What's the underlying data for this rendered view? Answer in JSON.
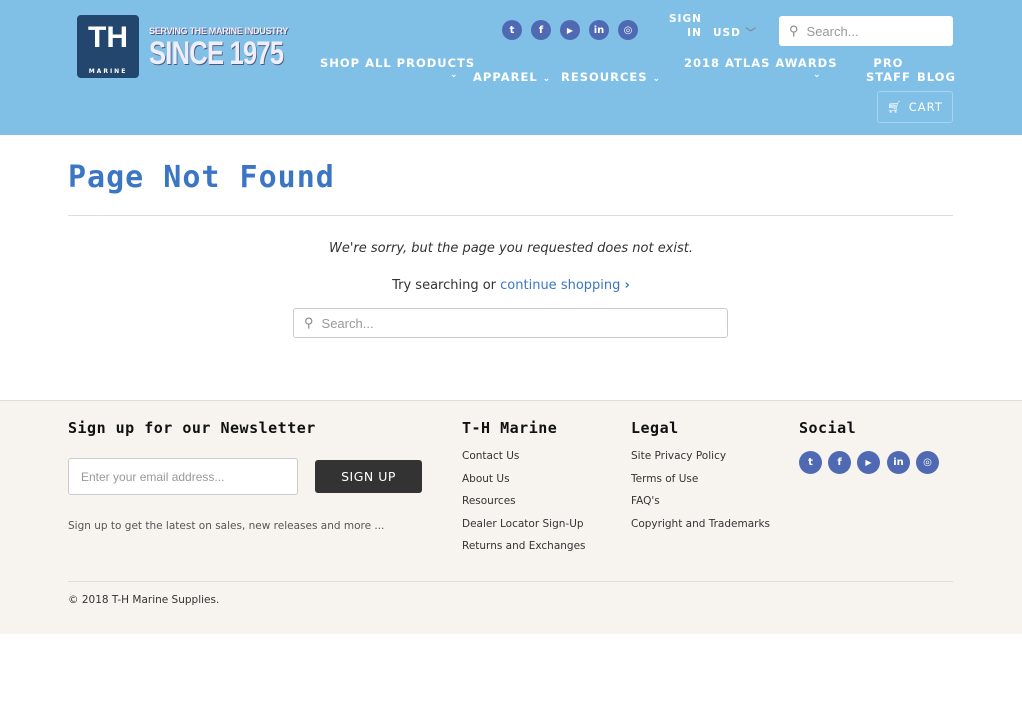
{
  "header": {
    "logo": {
      "mark": "TH",
      "sub": "MARINE"
    },
    "tagline": {
      "small": "SERVING THE MARINE INDUSTRY",
      "big": "SINCE 1975"
    },
    "social": [
      {
        "icon": "twitter-icon",
        "glyph": "t"
      },
      {
        "icon": "facebook-icon",
        "glyph": "f"
      },
      {
        "icon": "youtube-icon",
        "glyph": "▶"
      },
      {
        "icon": "linkedin-icon",
        "glyph": "in"
      },
      {
        "icon": "instagram-icon",
        "glyph": "◎"
      }
    ],
    "sign_in_1": "SIGN",
    "sign_in_2": "IN",
    "currency": "USD",
    "search_placeholder": "Search...",
    "nav": {
      "shop": "SHOP ALL PRODUCTS",
      "apparel": "APPAREL",
      "resources": "RESOURCES",
      "atlas": "2018 ATLAS AWARDS",
      "pro1": "PRO",
      "pro2": "STAFF",
      "blog": "BLOG",
      "chevron": "⌄"
    },
    "cart": "CART"
  },
  "main": {
    "title": "Page Not Found",
    "sorry": "We're sorry, but the page you requested does not exist.",
    "try": "Try searching or ",
    "continue": "continue shopping",
    "search_placeholder": "Search..."
  },
  "footer": {
    "newsletter_title": "Sign up for our Newsletter",
    "email_placeholder": "Enter your email address...",
    "signup": "SIGN UP",
    "signup_note": "Sign up to get the latest on sales, new releases and more ...",
    "company_title": "T-H Marine",
    "company_links": [
      "Contact Us",
      "About Us",
      "Resources",
      "Dealer Locator Sign-Up",
      "Returns and Exchanges"
    ],
    "legal_title": "Legal",
    "legal_links": [
      "Site Privacy Policy",
      "Terms of Use",
      "FAQ's",
      "Copyright and Trademarks"
    ],
    "social_title": "Social",
    "copyright": "© 2018 ",
    "company_name": "T-H Marine Supplies."
  },
  "colors": {
    "header_bg": "#80c0e7",
    "accent": "#3b76c4",
    "social": "#4f6ab2",
    "footer_bg": "#f7f4ef"
  }
}
